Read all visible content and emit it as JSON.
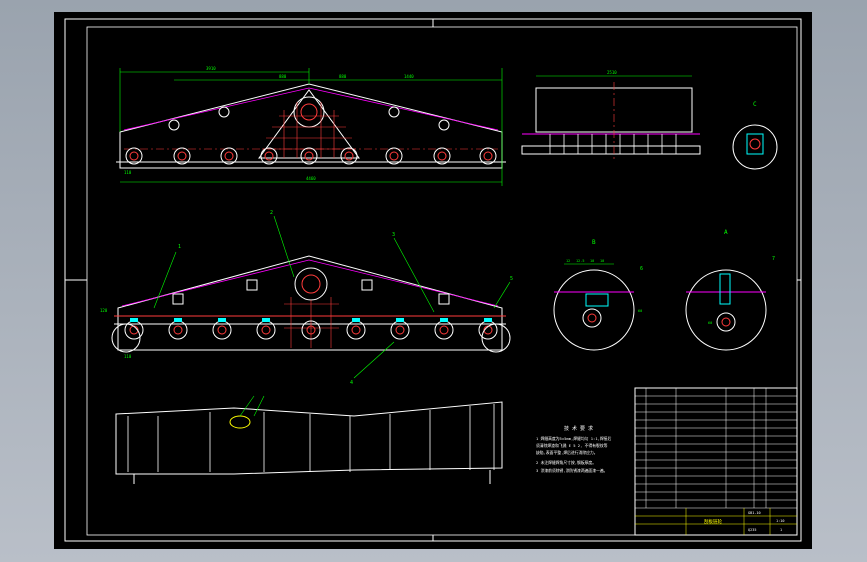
{
  "drawing": {
    "background": "#000000",
    "colors": {
      "outline": "#ffffff",
      "dimension": "#00ff00",
      "hidden": "#ff3b3b",
      "center": "#ff3b3b",
      "accent": "#00ffff",
      "magenta": "#ff00ff",
      "yellow": "#ffff00"
    },
    "dimensions": {
      "top_span_1": "3910",
      "top_span_2": "880",
      "top_span_3": "880",
      "top_span_4": "1440",
      "overall_width": "4460",
      "left_small_1": "110",
      "right_width": "2510",
      "bottom_left_1": "110",
      "bottom_left_2": "120",
      "detail_b_1": "12",
      "detail_b_2": "12.5",
      "detail_b_3": "10",
      "detail_b_4": "10",
      "detail_b_h": "60",
      "detail_a_h": "60"
    },
    "labels": {
      "section_c": "C",
      "section_b": "B",
      "section_a": "A",
      "leader_1": "1",
      "leader_2": "2",
      "leader_3": "3",
      "leader_4": "4",
      "leader_5": "5",
      "leader_6": "6",
      "leader_7": "7"
    },
    "notes_title": "技 术 要 求",
    "notes": [
      "1  焊缝高度为5×5mm,焊缝均匀 1:1,焊接后",
      "   须清除焊渣和飞溅 E 5 2, 不得有裂纹等",
      "   缺陷,表面平整,焊后进行消除应力。",
      "2  未注焊缝焊角尺寸按,钢板厚度。",
      "3  涂漆前须除锈,涂防锈漆两遍面漆一遍。"
    ],
    "title_block": {
      "drawing_name": "刮板链轮",
      "drawing_no": "GB1-10",
      "scale": "1:10",
      "sheet": "1",
      "material": "Q235"
    }
  }
}
